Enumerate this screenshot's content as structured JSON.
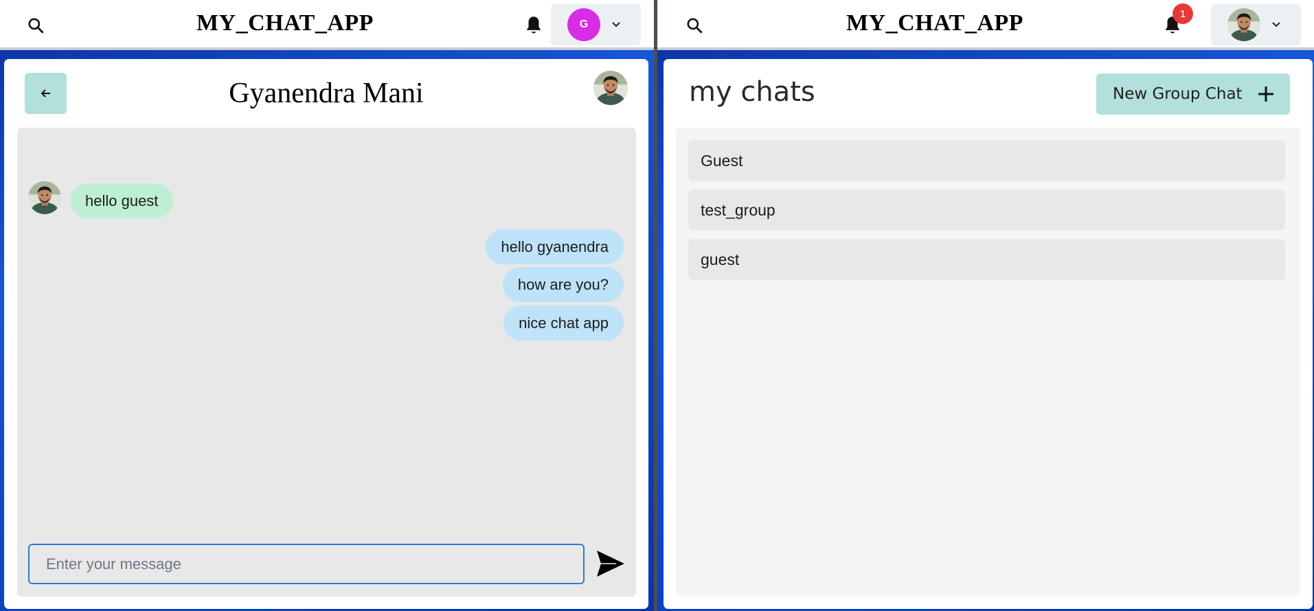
{
  "left_window": {
    "app_title": "MY_CHAT_APP",
    "user_menu": {
      "avatar_initial": "G"
    },
    "chat": {
      "title": "Gyanendra Mani",
      "messages": [
        {
          "text": "hello guest",
          "direction": "incoming"
        },
        {
          "text": "hello gyanendra",
          "direction": "outgoing"
        },
        {
          "text": "how are you?",
          "direction": "outgoing"
        },
        {
          "text": "nice chat app",
          "direction": "outgoing"
        }
      ],
      "input": {
        "value": "",
        "placeholder": "Enter your message"
      }
    }
  },
  "right_window": {
    "app_title": "MY_CHAT_APP",
    "notifications": {
      "count": "1"
    },
    "my_chats": {
      "title": "my chats",
      "new_group_label": "New Group Chat",
      "items": [
        {
          "name": "Guest"
        },
        {
          "name": "test_group"
        },
        {
          "name": "guest"
        }
      ]
    }
  },
  "colors": {
    "accent_teal": "#b2e0dc",
    "incoming_bubble": "#bfefd3",
    "outgoing_bubble": "#bee2f8",
    "avatar_magenta": "#d82ce6",
    "badge_red": "#e53935",
    "input_border": "#2f78d4"
  },
  "icons": [
    "search-icon",
    "bell-icon",
    "chevron-down-icon",
    "arrow-left-icon",
    "send-icon",
    "plus-icon"
  ]
}
